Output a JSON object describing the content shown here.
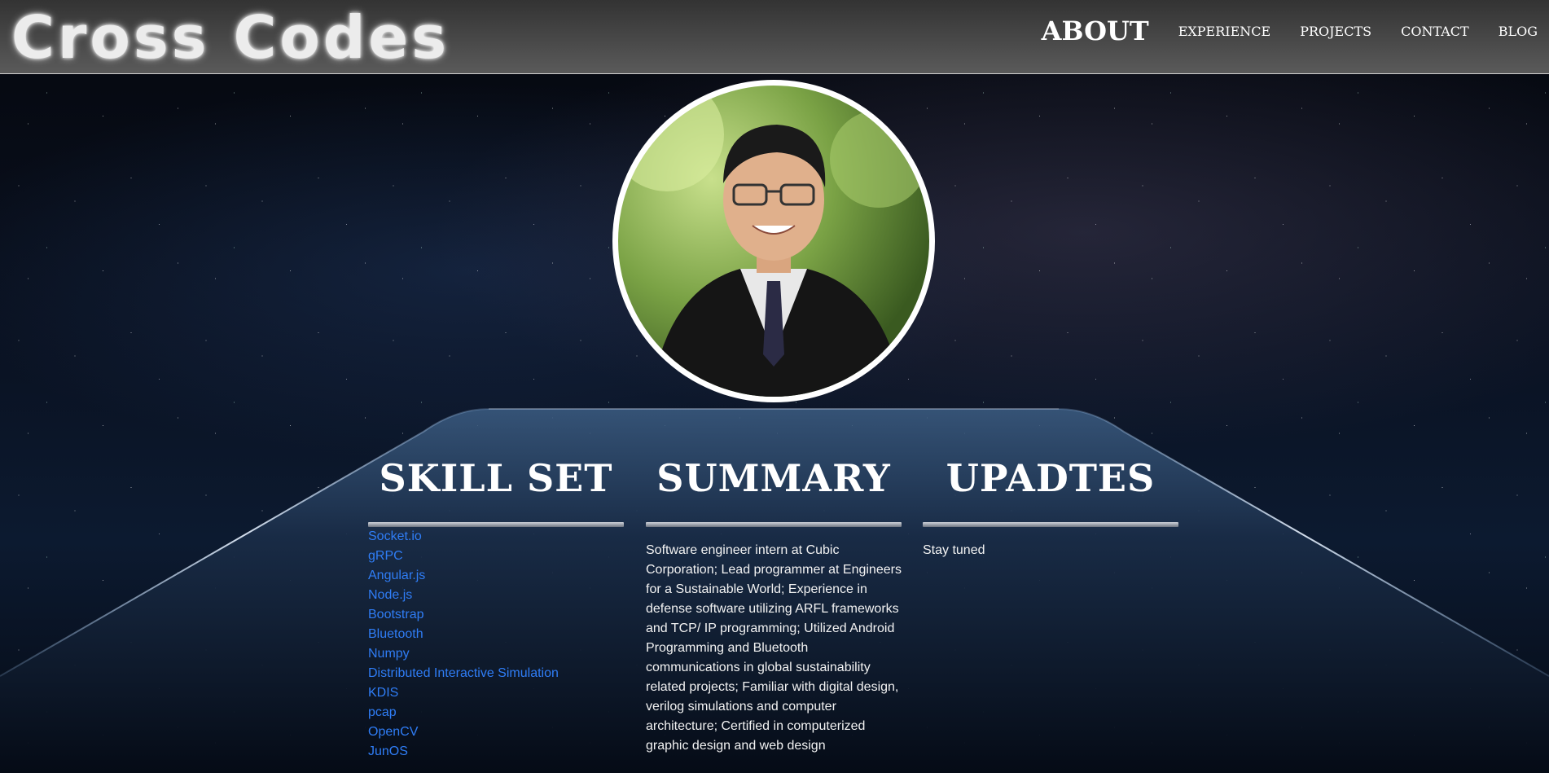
{
  "header": {
    "logo": "Cross Codes",
    "nav": [
      {
        "label": "ABOUT"
      },
      {
        "label": "EXPERIENCE"
      },
      {
        "label": "PROJECTS"
      },
      {
        "label": "CONTACT"
      },
      {
        "label": "BLOG"
      }
    ]
  },
  "sections": {
    "skills": {
      "title": "SKILL SET",
      "items": [
        "Socket.io",
        "gRPC",
        "Angular.js",
        "Node.js",
        "Bootstrap",
        "Bluetooth",
        "Numpy",
        "Distributed Interactive Simulation",
        "KDIS",
        "pcap",
        "OpenCV",
        "JunOS"
      ]
    },
    "summary": {
      "title": "SUMMARY",
      "text": "Software engineer intern at Cubic Corporation; Lead programmer at Engineers for a Sustainable World; Experience in defense software utilizing ARFL frameworks and TCP/ IP programming; Utilized Android Programming and Bluetooth communications in global sustainability related projects; Familiar with digital design, verilog simulations and computer architecture; Certified in computerized graphic design and web design"
    },
    "updates": {
      "title": "UPADTES",
      "text": "Stay tuned"
    }
  },
  "colors": {
    "link": "#2f7df6",
    "header_top": "#333333",
    "header_bottom": "#5a5a5a"
  }
}
